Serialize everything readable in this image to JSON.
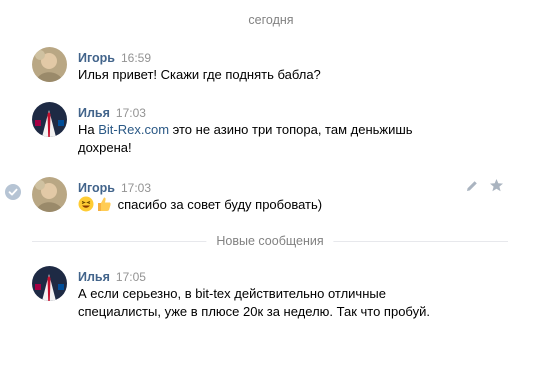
{
  "date_separator": "сегодня",
  "new_messages_label": "Новые сообщения",
  "messages": [
    {
      "author": "Игорь",
      "time": "16:59",
      "text": "Илья привет! Скажи где поднять бабла?"
    },
    {
      "author": "Илья",
      "time": "17:03",
      "link": "Bit-Rex.com",
      "text": " это не азино три топора, там деньжишь",
      "text2": "дохрена!",
      "prefix": "На "
    },
    {
      "author": "Игорь",
      "time": "17:03",
      "text": " спасибо за совет буду пробовать)"
    },
    {
      "author": "Илья",
      "time": "17:05",
      "text": "А если серьезно, в bit-tex действительно отличные",
      "text2": "специалисты, уже в плюсе 20к за неделю. Так что пробуй."
    }
  ],
  "colors": {
    "author": "#42648b",
    "link": "#2a5885",
    "meta": "#939393",
    "separator": "#e7e8ec"
  },
  "icons": [
    "selected-check-icon",
    "edit-pencil-icon",
    "star-icon",
    "laughing-emoji-icon",
    "thumbs-up-emoji-icon"
  ]
}
